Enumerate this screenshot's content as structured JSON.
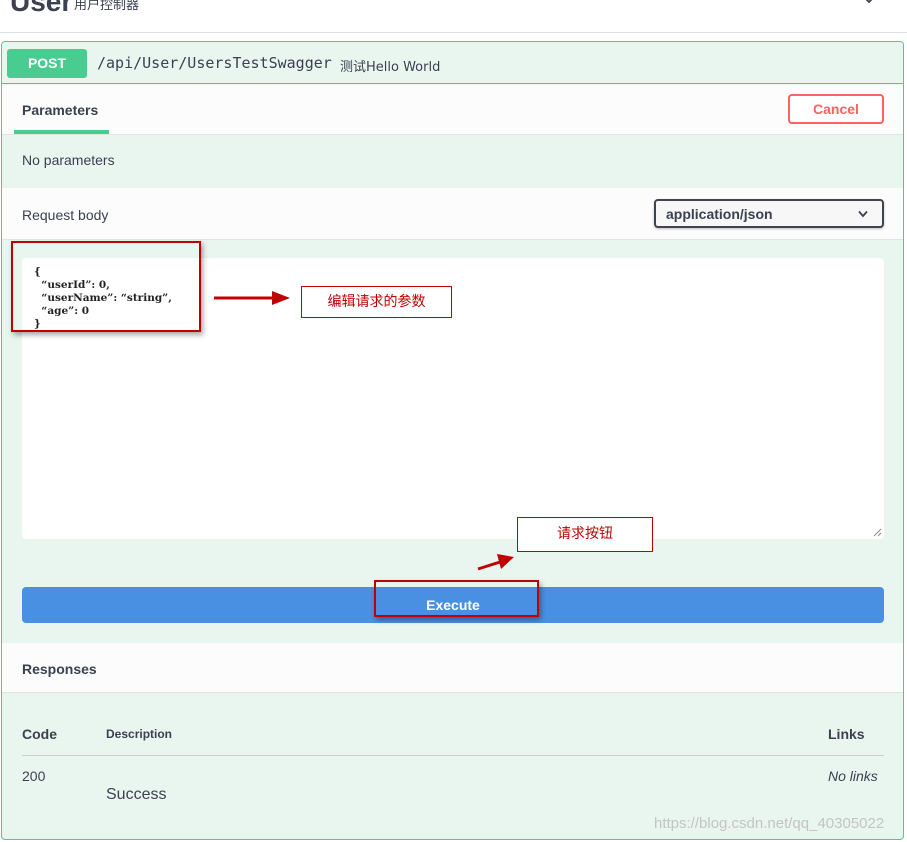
{
  "tag": {
    "title": "User",
    "description": "用户控制器"
  },
  "operation": {
    "method": "POST",
    "path": "/api/User/UsersTestSwagger",
    "summary": "测试Hello World"
  },
  "parameters": {
    "tab_label": "Parameters",
    "cancel_label": "Cancel",
    "empty_text": "No parameters"
  },
  "request_body": {
    "label": "Request body",
    "content_type": "application/json",
    "json_text": "{\n  “userId”: 0,\n  “userName”: “string”,\n  “age”: 0\n}"
  },
  "execute_label": "Execute",
  "responses": {
    "title": "Responses",
    "columns": {
      "code": "Code",
      "description": "Description",
      "links": "Links"
    },
    "rows": [
      {
        "code": "200",
        "description": "Success",
        "links": "No links"
      }
    ]
  },
  "annotations": {
    "edit_params": "编辑请求的参数",
    "request_button": "请求按钮"
  },
  "watermark": "https://blog.csdn.net/qq_40305022",
  "colors": {
    "post_green": "#49cc90",
    "post_bg": "#e9f6f0",
    "execute_blue": "#4990e2",
    "cancel_red": "#ff6060",
    "annotation_red": "#c00000"
  }
}
